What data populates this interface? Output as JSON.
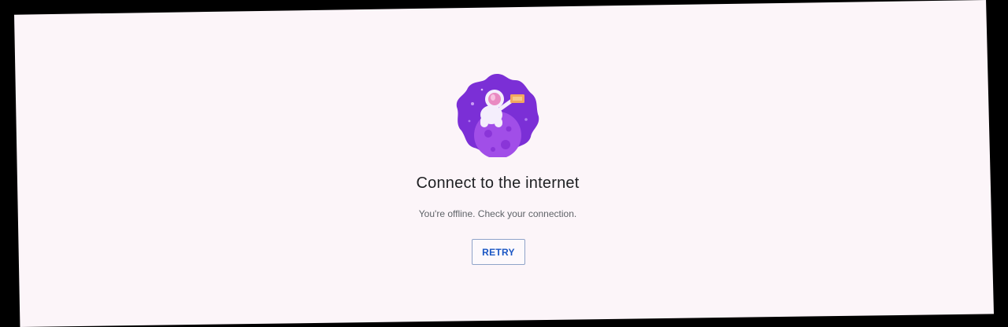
{
  "offline": {
    "illustration_icon": "astronaut-on-planet-icon",
    "title": "Connect to the internet",
    "message": "You're offline. Check your connection.",
    "retry_label": "RETRY"
  },
  "colors": {
    "background": "#fcf5f9",
    "title_text": "#202124",
    "message_text": "#5f6368",
    "button_text": "#1a56c4",
    "button_border": "#8fa3c9",
    "illustration_primary": "#7b2fd6",
    "illustration_planet": "#a14ee8"
  }
}
